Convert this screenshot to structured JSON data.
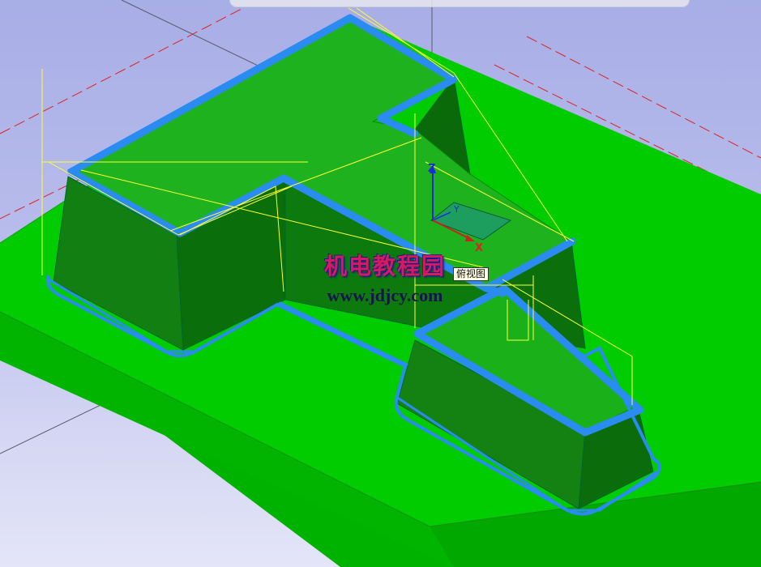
{
  "viewport": {
    "background_top": "#a8aee6",
    "background_bottom": "#e4e5f8",
    "view_label": "俯视图"
  },
  "model": {
    "plate_color": "#00cc00",
    "plate_side_color": "#00b200",
    "part_face_color": "#1fae1f",
    "part_wall_color": "#0b7c0b",
    "toolpath_color": "#2a8cf0",
    "wireframe_color": "#ffff33",
    "workplane_color": "#1f9a6a"
  },
  "axes": {
    "z_label": "Z",
    "y_label": "Y",
    "x_label": "X"
  },
  "watermark": {
    "cn": "机电教程园",
    "url": "www.jdjcy.com"
  }
}
